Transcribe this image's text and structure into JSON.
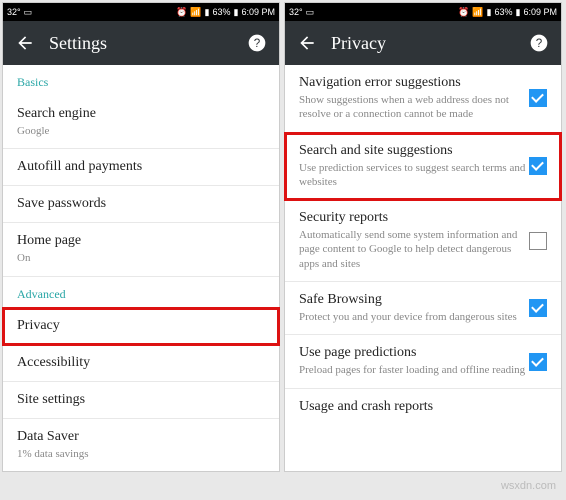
{
  "status": {
    "temp": "32°",
    "battery": "63%",
    "time": "6:09 PM"
  },
  "left": {
    "title": "Settings",
    "sections": {
      "basics": "Basics",
      "advanced": "Advanced"
    },
    "rows": {
      "search_engine": {
        "t": "Search engine",
        "s": "Google"
      },
      "autofill": {
        "t": "Autofill and payments"
      },
      "save_pw": {
        "t": "Save passwords"
      },
      "home": {
        "t": "Home page",
        "s": "On"
      },
      "privacy": {
        "t": "Privacy"
      },
      "accessibility": {
        "t": "Accessibility"
      },
      "site_settings": {
        "t": "Site settings"
      },
      "data_saver": {
        "t": "Data Saver",
        "s": "1% data savings"
      }
    }
  },
  "right": {
    "title": "Privacy",
    "rows": {
      "nav_err": {
        "t": "Navigation error suggestions",
        "s": "Show suggestions when a web address does not resolve or a connection cannot be made"
      },
      "search_site": {
        "t": "Search and site suggestions",
        "s": "Use prediction services to suggest search terms and websites"
      },
      "sec_reports": {
        "t": "Security reports",
        "s": "Automatically send some system information and page content to Google to help detect dangerous apps and sites"
      },
      "safe_browsing": {
        "t": "Safe Browsing",
        "s": "Protect you and your device from dangerous sites"
      },
      "page_pred": {
        "t": "Use page predictions",
        "s": "Preload pages for faster loading and offline reading"
      },
      "usage": {
        "t": "Usage and crash reports"
      }
    }
  },
  "watermark": "wsxdn.com"
}
